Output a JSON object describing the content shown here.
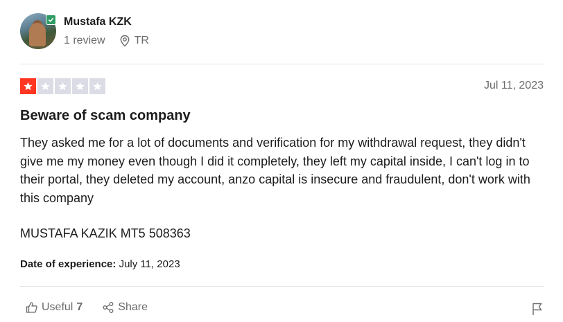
{
  "reviewer": {
    "name": "Mustafa KZK",
    "review_count": "1 review",
    "country": "TR",
    "verified_icon": "verified-check-icon"
  },
  "review": {
    "rating": 1,
    "max_rating": 5,
    "date": "Jul 11, 2023",
    "title": "Beware of scam company",
    "body": "They asked me for a lot of documents and verification for my withdrawal request, they didn't give me my money even though I did it completely, they left my capital inside, I can't log in to their portal, they deleted my account, anzo capital is insecure and fraudulent, don't work with this company",
    "extra_line": "MUSTAFA KAZIK MT5 508363",
    "experience_label": "Date of experience:",
    "experience_date": "July 11, 2023"
  },
  "actions": {
    "useful_label": "Useful",
    "useful_count": "7",
    "share_label": "Share"
  },
  "colors": {
    "star_active": "#ff3722",
    "star_inactive": "#dcdce6",
    "verified": "#2e9c64"
  }
}
